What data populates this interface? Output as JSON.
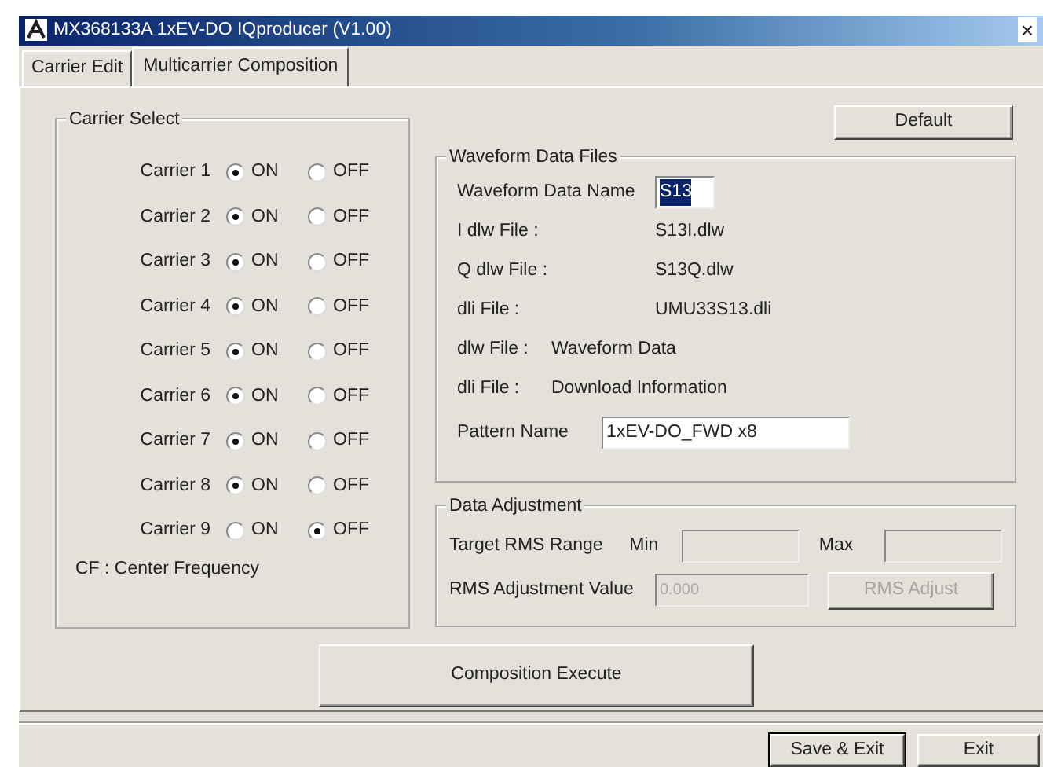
{
  "window": {
    "title": "MX368133A 1xEV-DO IQproducer (V1.00)",
    "close": "×"
  },
  "tabs": [
    {
      "label": "Carrier Edit",
      "selected": false
    },
    {
      "label": "Multicarrier Composition",
      "selected": true
    }
  ],
  "carrier_select": {
    "title": "Carrier Select",
    "carriers": [
      {
        "label": "Carrier 1",
        "options": [
          {
            "label": "ON",
            "selected": true
          },
          {
            "label": "OFF",
            "selected": false
          }
        ]
      },
      {
        "label": "Carrier 2",
        "options": [
          {
            "label": "ON",
            "selected": true
          },
          {
            "label": "OFF",
            "selected": false
          }
        ]
      },
      {
        "label": "Carrier 3",
        "options": [
          {
            "label": "ON",
            "selected": true
          },
          {
            "label": "OFF",
            "selected": false
          }
        ]
      },
      {
        "label": "Carrier 4",
        "options": [
          {
            "label": "ON",
            "selected": true
          },
          {
            "label": "OFF",
            "selected": false
          }
        ]
      },
      {
        "label": "Carrier 5",
        "options": [
          {
            "label": "ON",
            "selected": true
          },
          {
            "label": "OFF",
            "selected": false
          }
        ]
      },
      {
        "label": "Carrier 6",
        "options": [
          {
            "label": "ON",
            "selected": true
          },
          {
            "label": "OFF",
            "selected": false
          }
        ]
      },
      {
        "label": "Carrier 7",
        "options": [
          {
            "label": "ON",
            "selected": true
          },
          {
            "label": "OFF",
            "selected": false
          }
        ]
      },
      {
        "label": "Carrier 8",
        "options": [
          {
            "label": "ON",
            "selected": true
          },
          {
            "label": "OFF",
            "selected": false
          }
        ]
      },
      {
        "label": "Carrier 9",
        "options": [
          {
            "label": "ON",
            "selected": false
          },
          {
            "label": "OFF",
            "selected": true
          }
        ]
      }
    ],
    "note": "CF : Center Frequency"
  },
  "default_button": "Default",
  "waveform_data_files": {
    "title": "Waveform Data Files",
    "waveform_data_name": {
      "label": "Waveform Data Name",
      "value": "S13",
      "text_selected": true
    },
    "files": [
      {
        "label": "I dlw File :",
        "value": "S13I.dlw"
      },
      {
        "label": "Q dlw File :",
        "value": "S13Q.dlw"
      },
      {
        "label": "dli File :",
        "value": "UMU33S13.dli"
      }
    ],
    "legend": [
      {
        "label": "dlw File :",
        "value": "Waveform Data"
      },
      {
        "label": "dli File :",
        "value": "Download Information"
      }
    ],
    "pattern_name": {
      "label": "Pattern Name",
      "value": "1xEV-DO_FWD x8"
    }
  },
  "data_adjustment": {
    "title": "Data Adjustment",
    "target_rms_range": "Target RMS Range",
    "min_label": "Min",
    "max_label": "Max",
    "rms_adjustment_value": {
      "label": "RMS Adjustment Value",
      "value": "0.000"
    },
    "rms_adjust_button": {
      "label": "RMS Adjust",
      "disabled": true
    },
    "disabled": true
  },
  "composition_execute": "Composition Execute",
  "footer_buttons": [
    {
      "label": "Save & Exit",
      "default": true
    },
    {
      "label": "Exit",
      "default": false
    }
  ]
}
